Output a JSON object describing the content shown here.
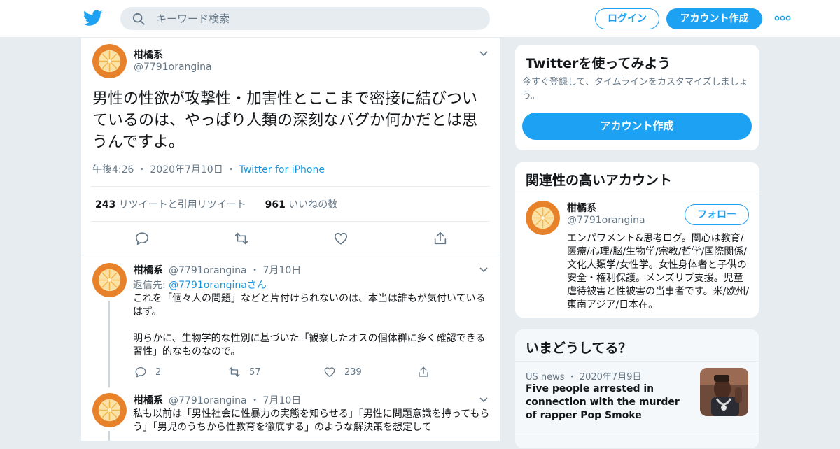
{
  "colors": {
    "brand": "#1da1f2",
    "link": "#1b95e0",
    "text": "#14171a",
    "muted": "#657786",
    "border": "#e6ecf0",
    "avatar_orange": "#e8822a"
  },
  "header": {
    "logo": "twitter-bird-icon",
    "search_placeholder": "キーワード検索",
    "login_label": "ログイン",
    "signup_label": "アカウント作成"
  },
  "tweet": {
    "name": "柑橘系",
    "handle": "@7791orangina",
    "text": "男性の性欲が攻撃性・加害性とここまで密接に結びついているのは、やっぱり人類の深刻なバグか何かだとは思うんですよ。",
    "time": "午後4:26",
    "date": "2020年7月10日",
    "source": "Twitter for iPhone",
    "retweets_count": "243",
    "retweets_label": "リツイートと引用リツイート",
    "likes_count": "961",
    "likes_label": "いいねの数"
  },
  "replies": [
    {
      "name": "柑橘系",
      "handle": "@7791orangina",
      "date": "7月10日",
      "reply_to_prefix": "返信先: ",
      "reply_to_handle": "@7791oranginaさん",
      "text_1": "これを「個々人の問題」などと片付けられないのは、本当は誰もが気付いているはず。",
      "text_2": "明らかに、生物学的な性別に基づいた「観察したオスの個体群に多く確認できる習性」的なものなので。",
      "reply_count": "2",
      "retweet_count": "57",
      "like_count": "239"
    },
    {
      "name": "柑橘系",
      "handle": "@7791orangina",
      "date": "7月10日",
      "text": "私も以前は「男性社会に性暴力の実態を知らせる」「男性に問題意識を持ってもらう」「男児のうちから性教育を徹底する」のような解決策を想定して"
    }
  ],
  "try_card": {
    "title": "Twitterを使ってみよう",
    "subtitle": "今すぐ登録して、タイムラインをカスタマイズしましょう。",
    "button": "アカウント作成"
  },
  "related_card": {
    "title": "関連性の高いアカウント",
    "name": "柑橘系",
    "handle": "@7791orangina",
    "follow_label": "フォロー",
    "bio": "エンパワメント&思考ログ。関心は教育/医療/心理/脳/生物学/宗教/哲学/国際関係/文化人類学/女性学。女性身体者と子供の安全・権利保護。メンズリブ支援。児童虐待被害と性被害の当事者です。米/欧州/東南アジア/日本在。"
  },
  "trends_card": {
    "title": "いまどうしてる？",
    "items": [
      {
        "category": "US news",
        "date": "2020年7月9日",
        "headline": "Five people arrested in connection with the murder of rapper Pop Smoke"
      }
    ]
  }
}
